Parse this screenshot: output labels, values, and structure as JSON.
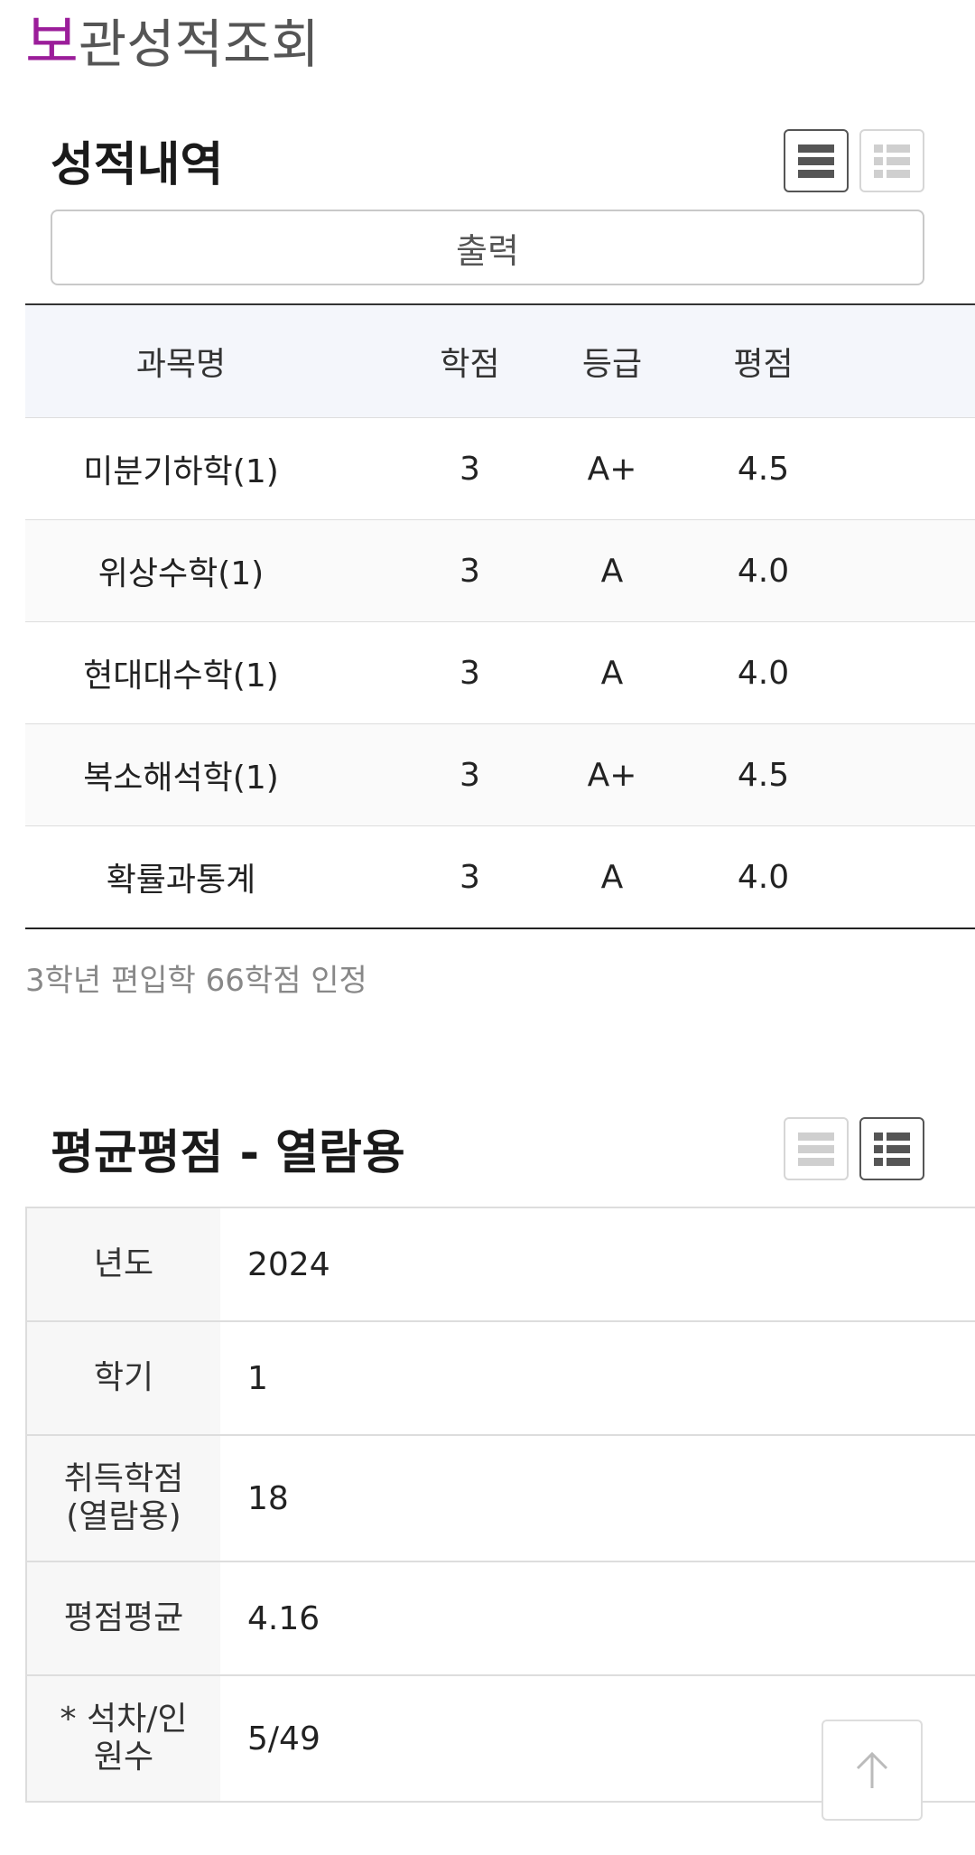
{
  "header": {
    "title_first_char": "보",
    "title_rest": "관성적조회"
  },
  "grades_section": {
    "title": "성적내역",
    "print_label": "출력",
    "columns": [
      "과목명",
      "학점",
      "등급",
      "평점"
    ],
    "rows": [
      {
        "subject": "미분기하학(1)",
        "credit": "3",
        "grade": "A+",
        "point": "4.5"
      },
      {
        "subject": "위상수학(1)",
        "credit": "3",
        "grade": "A",
        "point": "4.0"
      },
      {
        "subject": "현대대수학(1)",
        "credit": "3",
        "grade": "A",
        "point": "4.0"
      },
      {
        "subject": "복소해석학(1)",
        "credit": "3",
        "grade": "A+",
        "point": "4.5"
      },
      {
        "subject": "확률과통계",
        "credit": "3",
        "grade": "A",
        "point": "4.0"
      }
    ],
    "note": "3학년 편입학 66학점 인정"
  },
  "average_section": {
    "title": "평균평점 - 열람용",
    "rows": [
      {
        "label_line1": "년도",
        "label_line2": "",
        "value": "2024"
      },
      {
        "label_line1": "학기",
        "label_line2": "",
        "value": "1"
      },
      {
        "label_line1": "취득학점",
        "label_line2": "(열람용)",
        "value": "18"
      },
      {
        "label_line1": "평점평균",
        "label_line2": "",
        "value": "4.16"
      },
      {
        "label_line1": "* 석차/인",
        "label_line2": "원수",
        "value": "5/49"
      }
    ]
  },
  "icons": {
    "list_view": "list-view-icon",
    "detail_view": "detail-list-icon",
    "scroll_top": "arrow-up-icon"
  },
  "colors": {
    "accent": "#9b1d9a",
    "table_header_bg": "#f4f6fb",
    "label_bg": "#f7f7f7"
  }
}
